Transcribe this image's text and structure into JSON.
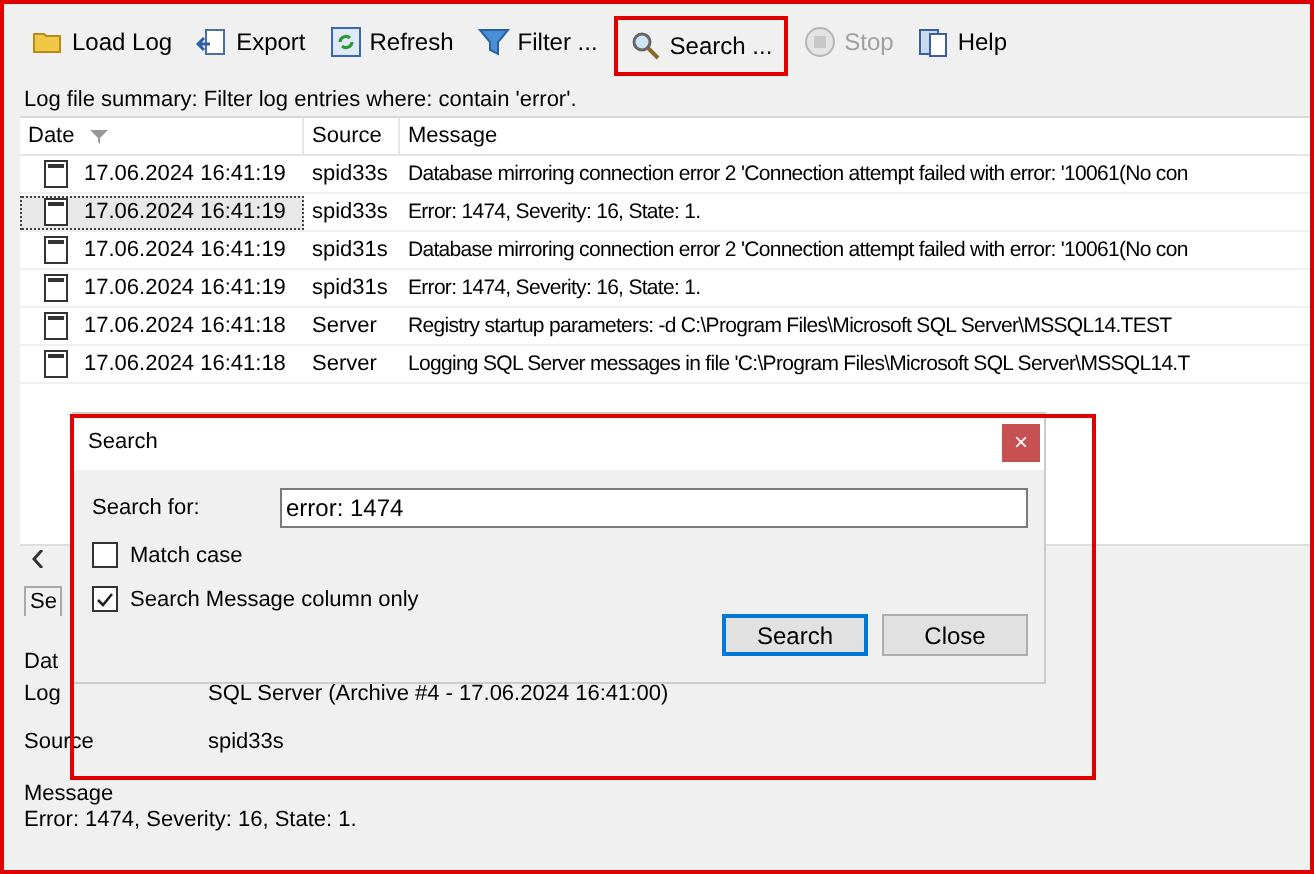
{
  "toolbar": [
    {
      "label": "Load Log",
      "disabled": false,
      "highlighted": false
    },
    {
      "label": "Export",
      "disabled": false,
      "highlighted": false
    },
    {
      "label": "Refresh",
      "disabled": false,
      "highlighted": false
    },
    {
      "label": "Filter ...",
      "disabled": false,
      "highlighted": false
    },
    {
      "label": "Search ...",
      "disabled": false,
      "highlighted": true
    },
    {
      "label": "Stop",
      "disabled": true,
      "highlighted": false
    },
    {
      "label": "Help",
      "disabled": false,
      "highlighted": false
    }
  ],
  "summary": "Log file summary: Filter log entries where: contain 'error'.",
  "table": {
    "columns": [
      "Date",
      "Source",
      "Message"
    ],
    "rows": [
      {
        "date": "17.06.2024 16:41:19",
        "source": "spid33s",
        "message": "Database mirroring connection error 2 'Connection attempt failed with error: '10061(No con",
        "selected": false
      },
      {
        "date": "17.06.2024 16:41:19",
        "source": "spid33s",
        "message": "Error: 1474, Severity: 16, State: 1.",
        "selected": true
      },
      {
        "date": "17.06.2024 16:41:19",
        "source": "spid31s",
        "message": "Database mirroring connection error 2 'Connection attempt failed with error: '10061(No con",
        "selected": false
      },
      {
        "date": "17.06.2024 16:41:19",
        "source": "spid31s",
        "message": "Error: 1474, Severity: 16, State: 1.",
        "selected": false
      },
      {
        "date": "17.06.2024 16:41:18",
        "source": "Server",
        "message": "Registry startup parameters:     -d C:\\Program Files\\Microsoft SQL Server\\MSSQL14.TEST",
        "selected": false
      },
      {
        "date": "17.06.2024 16:41:18",
        "source": "Server",
        "message": "Logging SQL Server messages in file 'C:\\Program Files\\Microsoft SQL Server\\MSSQL14.T",
        "selected": false
      }
    ]
  },
  "details": {
    "header": "Se",
    "labels": [
      "Dat",
      "Log"
    ],
    "log_value": "SQL Server (Archive #4 - 17.06.2024 16:41:00)",
    "source_label": "Source",
    "source_value": "spid33s",
    "message_label": "Message",
    "message_value": "Error: 1474, Severity: 16, State: 1."
  },
  "dialog": {
    "title": "Search",
    "close": "×",
    "search_label": "Search for:",
    "search_value": "error: 1474",
    "options": [
      {
        "label": "Match case",
        "checked": false
      },
      {
        "label": "Search Message column only",
        "checked": true
      }
    ],
    "buttons": [
      {
        "label": "Search",
        "default": true
      },
      {
        "label": "Close",
        "default": false
      }
    ]
  }
}
